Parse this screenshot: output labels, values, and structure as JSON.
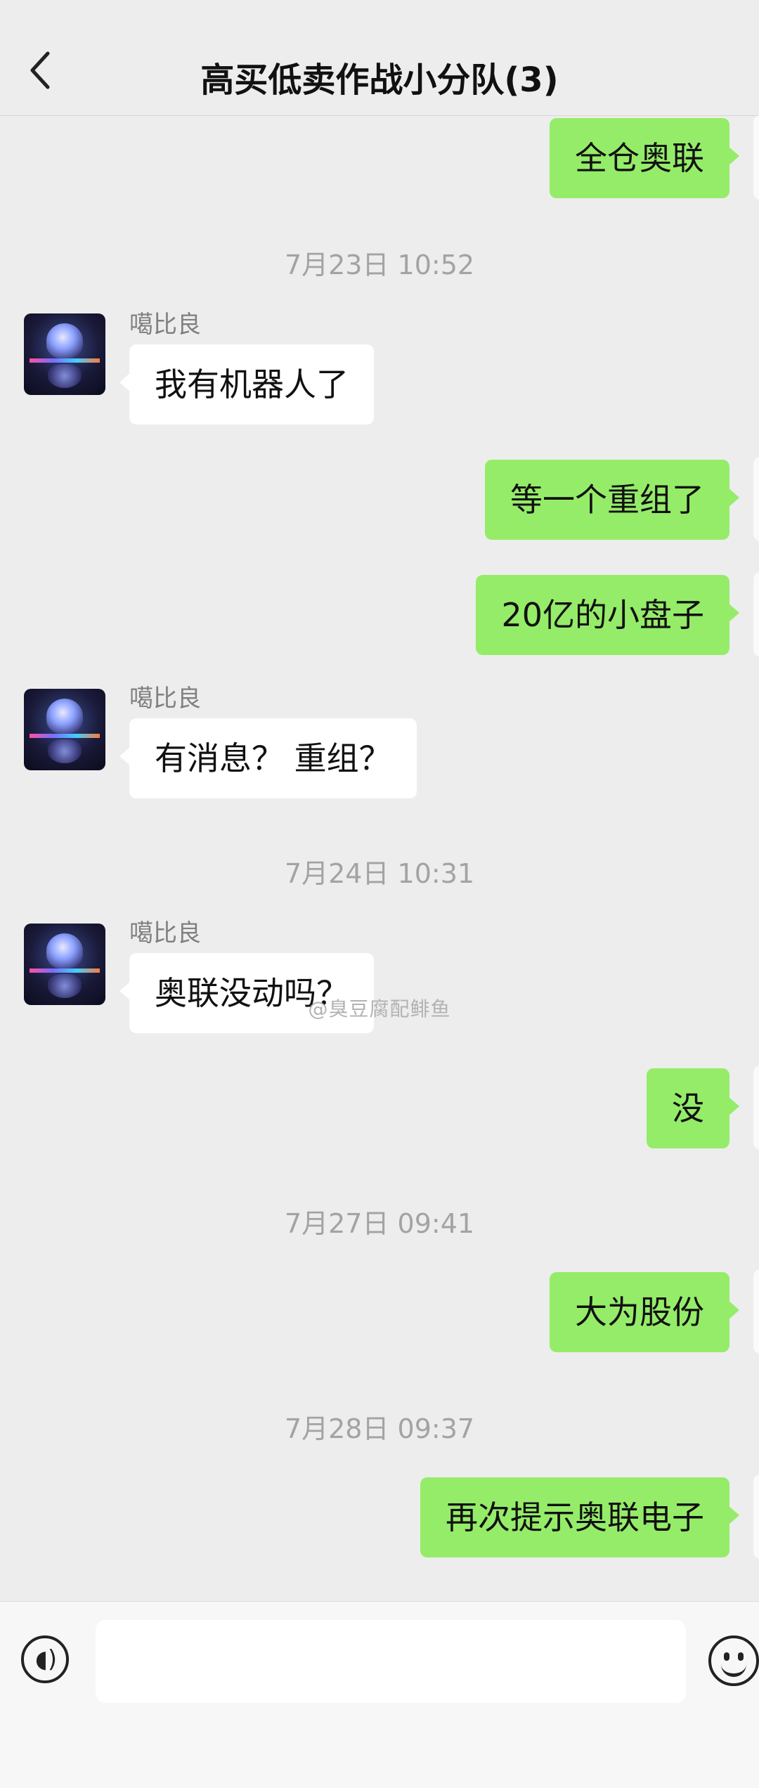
{
  "header": {
    "title": "高买低卖作战小分队(3)"
  },
  "messages": [
    {
      "type": "bubble",
      "side": "me",
      "text": "全仓奥联"
    },
    {
      "type": "time",
      "text": "7月23日 10:52"
    },
    {
      "type": "bubble",
      "side": "other",
      "sender": "噶比良",
      "text": "我有机器人了"
    },
    {
      "type": "bubble",
      "side": "me",
      "text": "等一个重组了"
    },
    {
      "type": "bubble",
      "side": "me",
      "text": "20亿的小盘子"
    },
    {
      "type": "bubble",
      "side": "other",
      "sender": "噶比良",
      "text": "有消息？ 重组？"
    },
    {
      "type": "time",
      "text": "7月24日 10:31"
    },
    {
      "type": "bubble",
      "side": "other",
      "sender": "噶比良",
      "text": "奥联没动吗？"
    },
    {
      "type": "bubble",
      "side": "me",
      "text": "没"
    },
    {
      "type": "time",
      "text": "7月27日 09:41"
    },
    {
      "type": "bubble",
      "side": "me",
      "text": "大为股份"
    },
    {
      "type": "time",
      "text": "7月28日 09:37"
    },
    {
      "type": "bubble",
      "side": "me",
      "text": "再次提示奥联电子"
    }
  ],
  "watermark": "@臭豆腐配鲱鱼",
  "input": {
    "placeholder": "",
    "value": ""
  },
  "icons": {
    "back": "back-chevron-icon",
    "voice": "voice-input-icon",
    "emoji": "emoji-icon"
  }
}
